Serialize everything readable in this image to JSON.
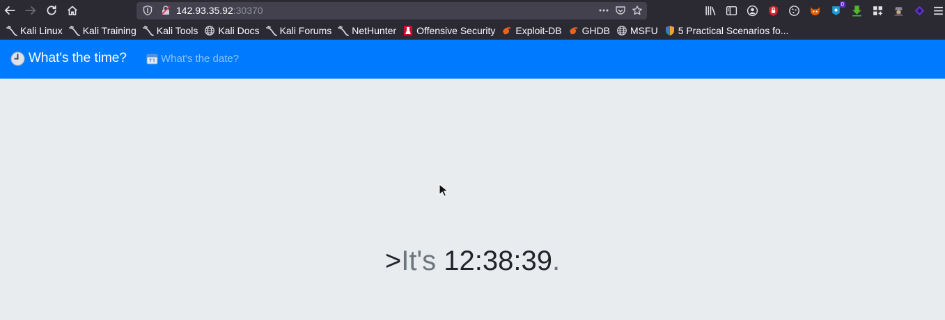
{
  "browser": {
    "url_host": "142.93.35.92",
    "url_port": ":30370",
    "notification_count": "0",
    "bookmarks": [
      {
        "label": "Kali Linux",
        "icon": "kali-dragon-icon"
      },
      {
        "label": "Kali Training",
        "icon": "kali-dragon-icon"
      },
      {
        "label": "Kali Tools",
        "icon": "kali-dragon-icon"
      },
      {
        "label": "Kali Docs",
        "icon": "globe-icon"
      },
      {
        "label": "Kali Forums",
        "icon": "kali-dragon-icon"
      },
      {
        "label": "NetHunter",
        "icon": "kali-dragon-icon"
      },
      {
        "label": "Offensive Security",
        "icon": "offsec-icon"
      },
      {
        "label": "Exploit-DB",
        "icon": "exploitdb-icon"
      },
      {
        "label": "GHDB",
        "icon": "exploitdb-icon"
      },
      {
        "label": "MSFU",
        "icon": "globe-icon"
      },
      {
        "label": "5 Practical Scenarios fo...",
        "icon": "shield-bookmark-icon"
      }
    ]
  },
  "page": {
    "brand": "What's the time?",
    "nav_link": "What's the date?",
    "prefix": ">",
    "its": "It's",
    "time": "12:38:39",
    "suffix": "."
  },
  "colors": {
    "navbar": "#007bff",
    "background": "#e9ecef",
    "muted_text": "#6c757d",
    "dark_text": "#212529"
  }
}
